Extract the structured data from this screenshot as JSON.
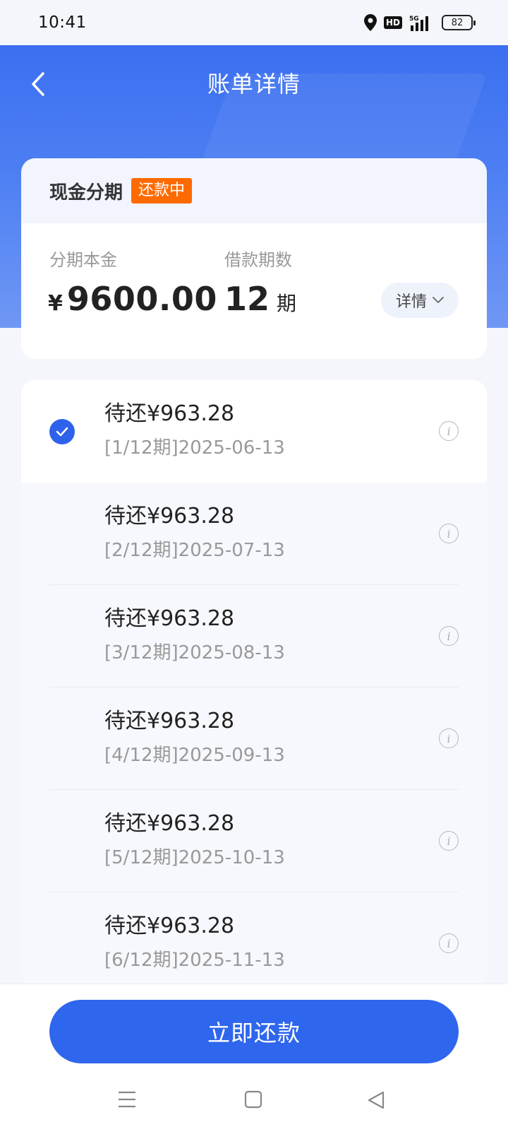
{
  "status_bar": {
    "time": "10:41",
    "hd_label": "HD",
    "network": "5G",
    "battery": "82"
  },
  "header": {
    "title": "账单详情",
    "back_icon": "chevron-left-icon"
  },
  "summary": {
    "product_name": "现金分期",
    "status": "还款中",
    "principal_label": "分期本金",
    "currency": "¥",
    "principal_value": "9600.00",
    "periods_label": "借款期数",
    "periods_value": "12",
    "periods_unit": "期",
    "detail_label": "详情"
  },
  "schedule": [
    {
      "amount": "待还¥963.28",
      "date": "[1/12期]2025-06-13",
      "selected": true
    },
    {
      "amount": "待还¥963.28",
      "date": "[2/12期]2025-07-13",
      "selected": false
    },
    {
      "amount": "待还¥963.28",
      "date": "[3/12期]2025-08-13",
      "selected": false
    },
    {
      "amount": "待还¥963.28",
      "date": "[4/12期]2025-09-13",
      "selected": false
    },
    {
      "amount": "待还¥963.28",
      "date": "[5/12期]2025-10-13",
      "selected": false
    },
    {
      "amount": "待还¥963.28",
      "date": "[6/12期]2025-11-13",
      "selected": false
    }
  ],
  "footer": {
    "pay_button": "立即还款"
  },
  "colors": {
    "primary": "#2f66ee",
    "badge": "#ff6a00"
  }
}
